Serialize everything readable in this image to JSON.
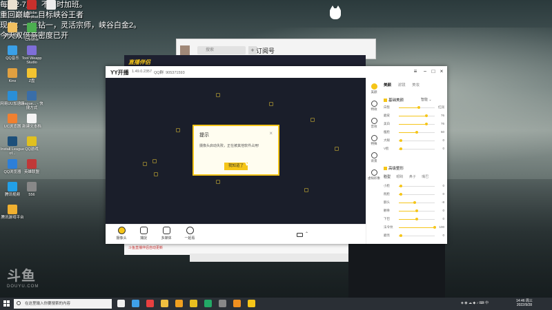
{
  "overlay": {
    "lines": [
      "每天2-7点，不定时加班。",
      "重回巅峰，目标峡谷王者",
      "现在：一区钻一，灵活宗师，峡谷白金2。",
      "今天双倍亲密度已开"
    ]
  },
  "desktop": {
    "icons": [
      {
        "label": "",
        "color": "#e8e0d0"
      },
      {
        "label": "Adobe Acrobat",
        "color": "#c8302c"
      },
      {
        "label": "",
        "color": "#ececec"
      },
      {
        "label": "腾讯视频",
        "color": "#f0c060"
      },
      {
        "label": "Google Chrome",
        "color": "#4caf50"
      },
      {
        "label": "QQ音乐",
        "color": "#3aa0e8"
      },
      {
        "label": "Tool Weapp Studio",
        "color": "#7e6ed8"
      },
      {
        "label": "Kinx",
        "color": "#e0a040"
      },
      {
        "label": "Z盘",
        "color": "#f4c430"
      },
      {
        "label": "网易UU加速器",
        "color": "#2a8fd8"
      },
      {
        "label": "League... - 快捷方式",
        "color": "#3a6ea8"
      },
      {
        "label": "UC浏览器",
        "color": "#f08030"
      },
      {
        "label": "新建文本档",
        "color": "#f4f4f4"
      },
      {
        "label": "Install League of...",
        "color": "#1c4f7a"
      },
      {
        "label": "QQ游戏",
        "color": "#e0c020"
      },
      {
        "label": "QQ浏览器",
        "color": "#2d7fd8"
      },
      {
        "label": "英雄联盟",
        "color": "#c03838"
      },
      {
        "label": "腾讯视频",
        "color": "#22a0e8"
      },
      {
        "label": "556",
        "color": "#888888"
      },
      {
        "label": "腾讯游戏平台",
        "color": "#f0b030"
      }
    ]
  },
  "watermark": {
    "main": "斗鱼",
    "sub": "DOUYU.COM"
  },
  "bg_windows": {
    "subscribe_title": "订阅号",
    "subscribe_search": "搜索",
    "live_logo": "直播伴侣",
    "strip_text": "斗鱼直播伴侣自动更新"
  },
  "yy": {
    "title": "YY开播",
    "version": "1.49.0.2357",
    "qq": "QQ群: 905371593",
    "window_controls": {
      "menu": "≡",
      "min": "−",
      "max": "□",
      "close": "×"
    },
    "toolbar": [
      {
        "label": "摄像头",
        "icon": "camera-lens-icon"
      },
      {
        "label": "捕捉",
        "icon": "capture-icon"
      },
      {
        "label": "多媒体",
        "icon": "media-icon"
      },
      {
        "label": "一起看",
        "icon": "watch-together-icon"
      }
    ],
    "sidenav": [
      {
        "label": "美颜",
        "icon": "beauty-icon",
        "active": true
      },
      {
        "label": "特效",
        "icon": "effects-icon",
        "active": false
      },
      {
        "label": "音效",
        "icon": "sound-icon",
        "active": false
      },
      {
        "label": "特殊",
        "icon": "tools-icon",
        "active": false
      },
      {
        "label": "背景",
        "icon": "background-icon",
        "active": false
      },
      {
        "label": "虚拟形象",
        "icon": "avatar-icon",
        "active": false
      }
    ],
    "panel": {
      "tabs": [
        "美颜",
        "滤镜",
        "美妆"
      ],
      "active_tab": "美颜",
      "section1": {
        "title": "基础美颜",
        "mode": "智能"
      },
      "sliders1": [
        {
          "label": "白皙",
          "value": "红润",
          "level": 0.55
        },
        {
          "label": "磨皮",
          "value": "76",
          "level": 0.76
        },
        {
          "label": "美白",
          "value": "76",
          "level": 0.76
        },
        {
          "label": "瘦脸",
          "value": "50",
          "level": 0.5
        },
        {
          "label": "大眼",
          "value": "0",
          "level": 0.05
        },
        {
          "label": "V脸",
          "value": "0",
          "level": 0.05
        }
      ],
      "section2": {
        "title": "高级整形"
      },
      "subtabs": [
        "脸型",
        "眼睛",
        "鼻子",
        "嘴巴"
      ],
      "sliders2": [
        {
          "label": "小脸",
          "value": "0",
          "level": 0.05
        },
        {
          "label": "削脸",
          "value": "0",
          "level": 0.05
        },
        {
          "label": "额头",
          "value": "-8",
          "level": 0.45
        },
        {
          "label": "颧骨",
          "value": "0",
          "level": 0.5
        },
        {
          "label": "下巴",
          "value": "0",
          "level": 0.5
        },
        {
          "label": "法令纹",
          "value": "100",
          "level": 1.0
        },
        {
          "label": "磨亮",
          "value": "0",
          "level": 0.05
        }
      ]
    }
  },
  "dialog": {
    "title": "提示",
    "message": "摄像头启动失败，正在被其他软件占用!",
    "button": "我知道了",
    "close": "×"
  },
  "taskbar": {
    "search_placeholder": "在这里输入你要搜索的内容",
    "time": "14:46 周三",
    "date": "2022/9/28",
    "apps": [
      "#f0f0f0",
      "#3fa0e8",
      "#e84040",
      "#f0c040",
      "#f0a020",
      "#e8c020",
      "#22aa66",
      "#888",
      "#f09020",
      "#f5c518"
    ]
  }
}
